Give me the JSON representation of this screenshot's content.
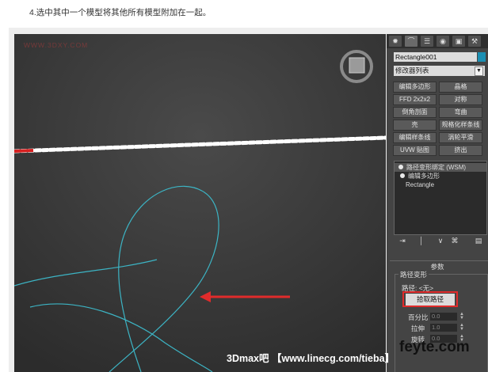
{
  "caption": "4.选中其中一个模型将其他所有模型附加在一起。",
  "viewport": {
    "watermark": "WWW.3DXY.COM",
    "footer_watermark": "3Dmax吧 【www.linecg.com/tieba】",
    "brand_watermark": "feyte.com",
    "viewcube_label": " "
  },
  "panel": {
    "tabs": [
      "✹",
      "⌒",
      "☰",
      "◉",
      "▣",
      "⚒"
    ],
    "object_name": "Rectangle001",
    "object_color": "#1b8fb3",
    "modifier_list": "修改器列表",
    "modifier_buttons": [
      [
        "编辑多边形",
        "晶格"
      ],
      [
        "FFD 2x2x2",
        "对称"
      ],
      [
        "倒角剖面",
        "弯曲"
      ],
      [
        "壳",
        "规格化样条线"
      ],
      [
        "编辑样条线",
        "涡轮平滑"
      ],
      [
        "UVW 贴图",
        "挤出"
      ]
    ],
    "stack": [
      "路径变形绑定 (WSM)",
      "编辑多边形",
      "Rectangle"
    ],
    "stack_tools": [
      "⇥",
      "│",
      "∨",
      "⌘",
      "▤"
    ],
    "params": {
      "title": "参数",
      "group": "路径变形",
      "path_label": "路径: <无>",
      "pick_path": "拾取路径",
      "percent_label": "百分比",
      "percent_value": "0.0",
      "stretch_label": "拉伸",
      "stretch_value": "1.0",
      "rotation_label": "旋转",
      "rotation_value": "0.0"
    }
  }
}
